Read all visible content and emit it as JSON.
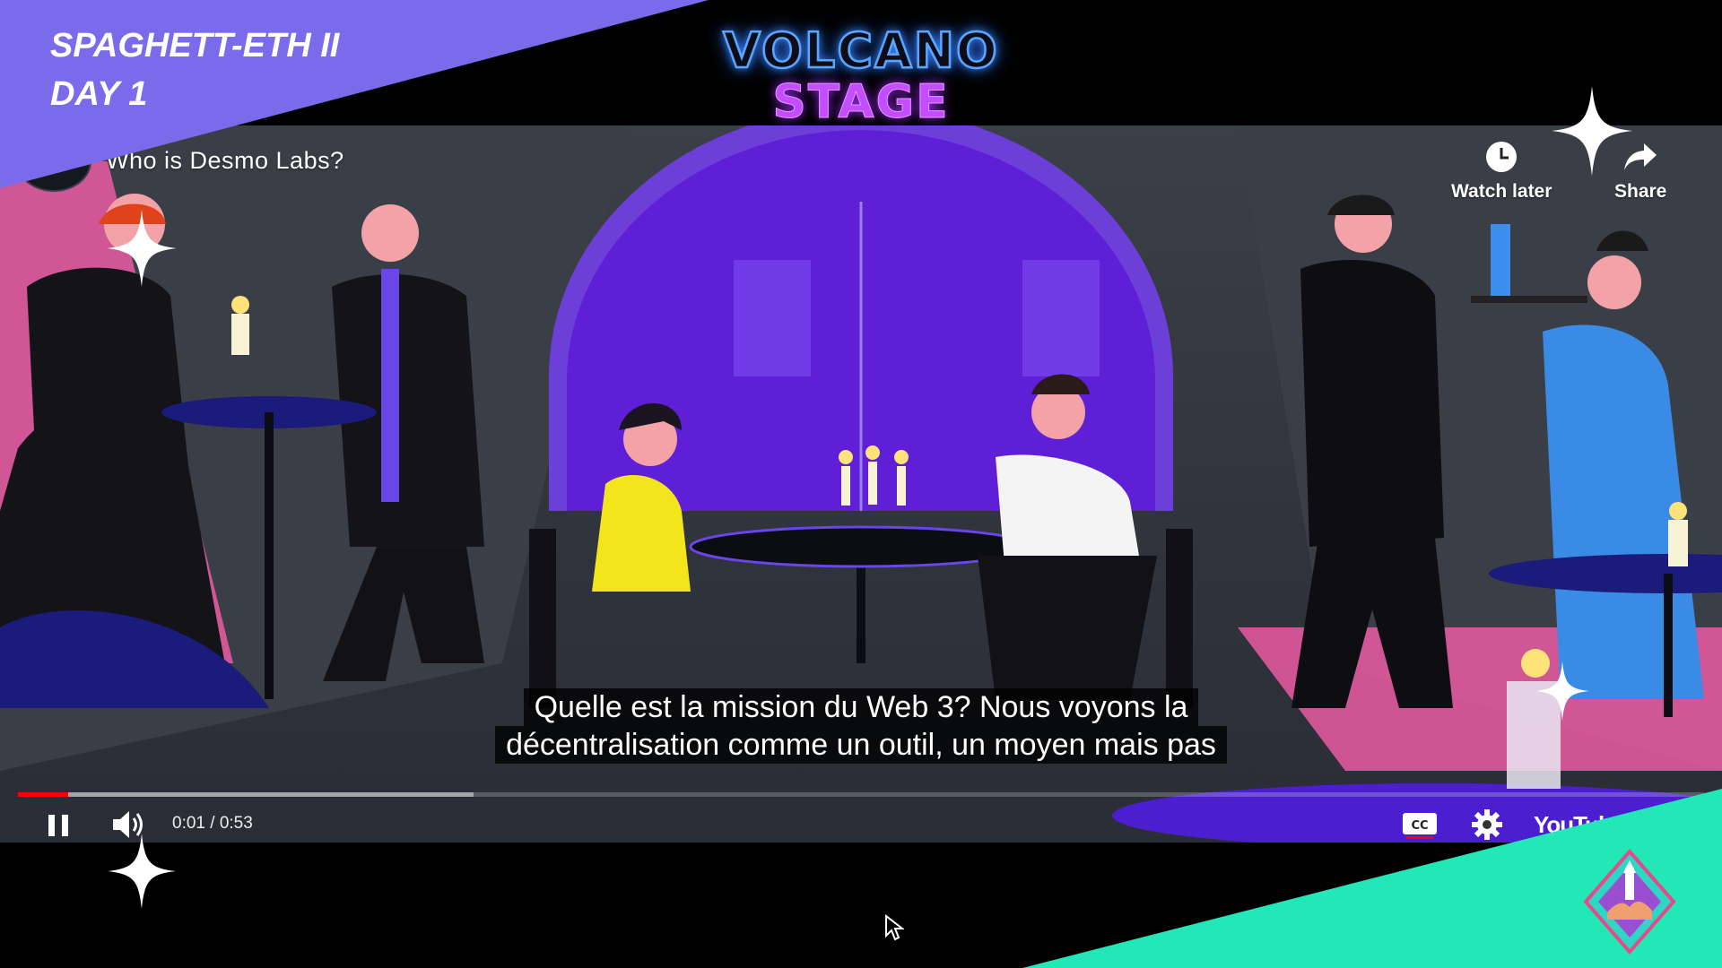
{
  "event": {
    "line1": "SPAGHETT-ETH II",
    "line2": "DAY 1",
    "stage_line1": "VOLCANO",
    "stage_line2": "STAGE"
  },
  "video": {
    "title": "Who is Desmo Labs?",
    "watch_later_label": "Watch later",
    "share_label": "Share",
    "subtitle_line1": "Quelle est la mission du Web 3? Nous voyons la",
    "subtitle_line2": "décentralisation comme un outil, un moyen mais pas",
    "time_display": "0:01 / 0:53",
    "youtube_label": "YouTube",
    "played_fraction": 0.03,
    "buffered_fraction": 0.27
  },
  "colors": {
    "banner_purple": "#7a6bea",
    "accent_teal": "#22e8b8",
    "progress_red": "#ff0000",
    "logo_blue": "#5aa6ff",
    "logo_purple": "#c44dff"
  },
  "icons": {
    "play_state": "pause-icon",
    "volume": "volume-icon",
    "captions": "closed-captions-icon",
    "settings": "gear-icon",
    "watch_later": "clock-icon",
    "share": "share-arrow-icon"
  }
}
